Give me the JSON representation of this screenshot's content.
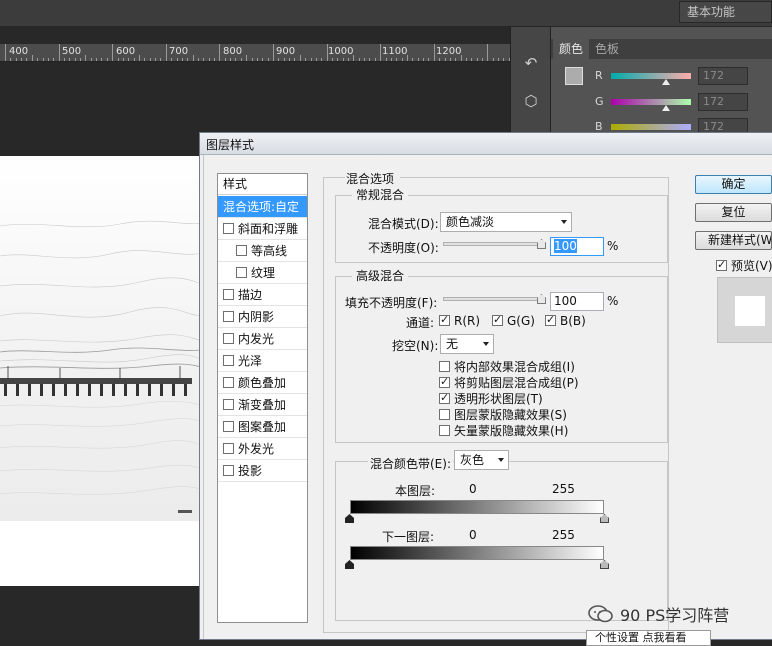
{
  "topbar": {
    "workspace": "基本功能"
  },
  "ruler": {
    "ticks": [
      "400",
      "500",
      "600",
      "700",
      "800",
      "900",
      "1000",
      "1100",
      "1200"
    ]
  },
  "color_panel": {
    "tabs": [
      "颜色",
      "色板"
    ],
    "sliders": [
      {
        "label": "R",
        "value": "172"
      },
      {
        "label": "G",
        "value": "172"
      },
      {
        "label": "B",
        "value": "172"
      }
    ]
  },
  "dialog": {
    "title": "图层样式",
    "styles": {
      "header": "样式",
      "items": [
        {
          "label": "混合选项:自定",
          "checkbox": false,
          "selected": true
        },
        {
          "label": "斜面和浮雕",
          "checkbox": true
        },
        {
          "label": "等高线",
          "checkbox": true,
          "indent": true
        },
        {
          "label": "纹理",
          "checkbox": true,
          "indent": true
        },
        {
          "label": "描边",
          "checkbox": true
        },
        {
          "label": "内阴影",
          "checkbox": true
        },
        {
          "label": "内发光",
          "checkbox": true
        },
        {
          "label": "光泽",
          "checkbox": true
        },
        {
          "label": "颜色叠加",
          "checkbox": true
        },
        {
          "label": "渐变叠加",
          "checkbox": true
        },
        {
          "label": "图案叠加",
          "checkbox": true
        },
        {
          "label": "外发光",
          "checkbox": true
        },
        {
          "label": "投影",
          "checkbox": true
        }
      ]
    },
    "blend_options": {
      "section_title": "混合选项",
      "general": {
        "title": "常规混合",
        "mode_label": "混合模式(D):",
        "mode_value": "颜色减淡",
        "opacity_label": "不透明度(O):",
        "opacity_value": "100",
        "unit": "%"
      },
      "advanced": {
        "title": "高级混合",
        "fill_label": "填充不透明度(F):",
        "fill_value": "100",
        "unit": "%",
        "channels_label": "通道:",
        "channels": [
          "R(R)",
          "G(G)",
          "B(B)"
        ],
        "knockout_label": "挖空(N):",
        "knockout_value": "无",
        "options": [
          {
            "label": "将内部效果混合成组(I)",
            "checked": false
          },
          {
            "label": "将剪贴图层混合成组(P)",
            "checked": true
          },
          {
            "label": "透明形状图层(T)",
            "checked": true
          },
          {
            "label": "图层蒙版隐藏效果(S)",
            "checked": false
          },
          {
            "label": "矢量蒙版隐藏效果(H)",
            "checked": false
          }
        ]
      },
      "blend_if": {
        "label": "混合颜色带(E):",
        "value": "灰色",
        "this_layer": "本图层:",
        "underlying": "下一图层:",
        "min": "0",
        "max": "255"
      }
    },
    "buttons": {
      "ok": "确定",
      "reset": "复位",
      "new_style": "新建样式(W)...",
      "preview": "预览(V)"
    }
  },
  "watermark": "90 PS学习阵营",
  "tooltip": "个性设置  点我看看"
}
